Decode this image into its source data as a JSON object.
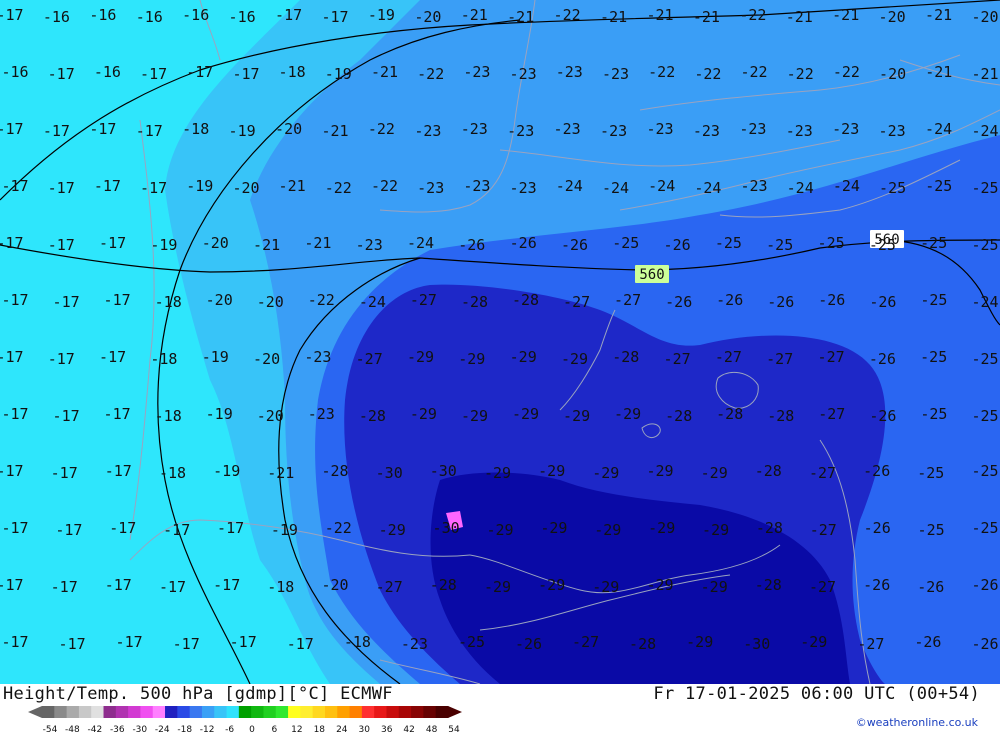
{
  "title": "Height/Temp. 500 hPa [gdmp][°C] ECMWF",
  "valid_time": "Fr 17-01-2025 06:00 UTC (00+54)",
  "credit": "©weatheronline.co.uk",
  "colors": {
    "t_le_minus30": "#0a0aa6",
    "t_minus30_to_minus26": "#1e28c8",
    "t_minus26_to_minus24": "#2a66f2",
    "t_minus24_to_minus20": "#3a9ef6",
    "t_minus20_to_minus18": "#38c4f8",
    "t_ge_minus18": "#2ee6fc",
    "coast_lines": "#9aa3c0",
    "height_contour": "#000000",
    "warm_spot": "#ff66ff"
  },
  "height_contours": [
    {
      "value": "560"
    }
  ],
  "temperature_rows": [
    [
      "-17",
      "-16",
      "-16",
      "-16",
      "-16",
      "-16",
      "-17",
      "-17",
      "-19",
      "-20",
      "-21",
      "-21",
      "-22",
      "-21",
      "-21",
      "-21",
      "-22",
      "-21",
      "-21",
      "-20",
      "-21",
      "-20"
    ],
    [
      "-16",
      "-17",
      "-16",
      "-17",
      "-17",
      "-17",
      "-18",
      "-19",
      "-21",
      "-22",
      "-23",
      "-23",
      "-23",
      "-23",
      "-22",
      "-22",
      "-22",
      "-22",
      "-22",
      "-20",
      "-21",
      "-21"
    ],
    [
      "-17",
      "-17",
      "-17",
      "-17",
      "-18",
      "-19",
      "-20",
      "-21",
      "-22",
      "-23",
      "-23",
      "-23",
      "-23",
      "-23",
      "-23",
      "-23",
      "-23",
      "-23",
      "-23",
      "-23",
      "-24",
      "-24"
    ],
    [
      "-17",
      "-17",
      "-17",
      "-17",
      "-19",
      "-20",
      "-21",
      "-22",
      "-22",
      "-23",
      "-23",
      "-23",
      "-24",
      "-24",
      "-24",
      "-24",
      "-23",
      "-24",
      "-24",
      "-25",
      "-25",
      "-25"
    ],
    [
      "-17",
      "-17",
      "-17",
      "-19",
      "-20",
      "-21",
      "-21",
      "-23",
      "-24",
      "-26",
      "-26",
      "-26",
      "-25",
      "-26",
      "-25",
      "-25",
      "-25",
      "-25",
      "-25",
      "-25"
    ],
    [
      "-17",
      "-17",
      "-17",
      "-18",
      "-20",
      "-20",
      "-22",
      "-24",
      "-27",
      "-28",
      "-28",
      "-27",
      "-27",
      "-26",
      "-26",
      "-26",
      "-26",
      "-26",
      "-25",
      "-24"
    ],
    [
      "-17",
      "-17",
      "-17",
      "-18",
      "-19",
      "-20",
      "-23",
      "-27",
      "-29",
      "-29",
      "-29",
      "-29",
      "-28",
      "-27",
      "-27",
      "-27",
      "-27",
      "-26",
      "-25",
      "-25"
    ],
    [
      "-17",
      "-17",
      "-17",
      "-18",
      "-19",
      "-20",
      "-23",
      "-28",
      "-29",
      "-29",
      "-29",
      "-29",
      "-29",
      "-28",
      "-28",
      "-28",
      "-27",
      "-26",
      "-25",
      "-25"
    ],
    [
      "-17",
      "-17",
      "-17",
      "-18",
      "-19",
      "-21",
      "-28",
      "-30",
      "-30",
      "-29",
      "-29",
      "-29",
      "-29",
      "-29",
      "-28",
      "-27",
      "-26",
      "-25",
      "-25"
    ],
    [
      "-17",
      "-17",
      "-17",
      "-17",
      "-17",
      "-19",
      "-22",
      "-29",
      "-30",
      "-29",
      "-29",
      "-29",
      "-29",
      "-29",
      "-28",
      "-27",
      "-26",
      "-25",
      "-25"
    ],
    [
      "-17",
      "-17",
      "-17",
      "-17",
      "-17",
      "-18",
      "-20",
      "-27",
      "-28",
      "-29",
      "-29",
      "-29",
      "-29",
      "-29",
      "-28",
      "-27",
      "-26",
      "-26",
      "-26"
    ],
    [
      "-17",
      "-17",
      "-17",
      "-17",
      "-17",
      "-17",
      "-18",
      "-23",
      "-25",
      "-26",
      "-27",
      "-28",
      "-29",
      "-30",
      "-29",
      "-27",
      "-26",
      "-26"
    ]
  ],
  "legend": {
    "tick_labels": [
      "-54",
      "-48",
      "-42",
      "-36",
      "-30",
      "-24",
      "-18",
      "-12",
      "-6",
      "0",
      "6",
      "12",
      "18",
      "24",
      "30",
      "36",
      "42",
      "48",
      "54"
    ],
    "colors": [
      "#666666",
      "#8a8a8a",
      "#aaaaaa",
      "#c8c8c8",
      "#e0e0e0",
      "#8e2d8e",
      "#b033b0",
      "#d23ad2",
      "#f050f0",
      "#ff7fff",
      "#2020c0",
      "#2a4ae6",
      "#3a78f0",
      "#3aa0f6",
      "#38c4f8",
      "#30e2fc",
      "#00a000",
      "#10b810",
      "#20d020",
      "#30e830",
      "#ffff20",
      "#ffee30",
      "#ffd820",
      "#ffc010",
      "#ffa000",
      "#ff8000",
      "#ff3030",
      "#e81818",
      "#c80c0c",
      "#a80606",
      "#880404",
      "#680202",
      "#4a0000"
    ]
  }
}
